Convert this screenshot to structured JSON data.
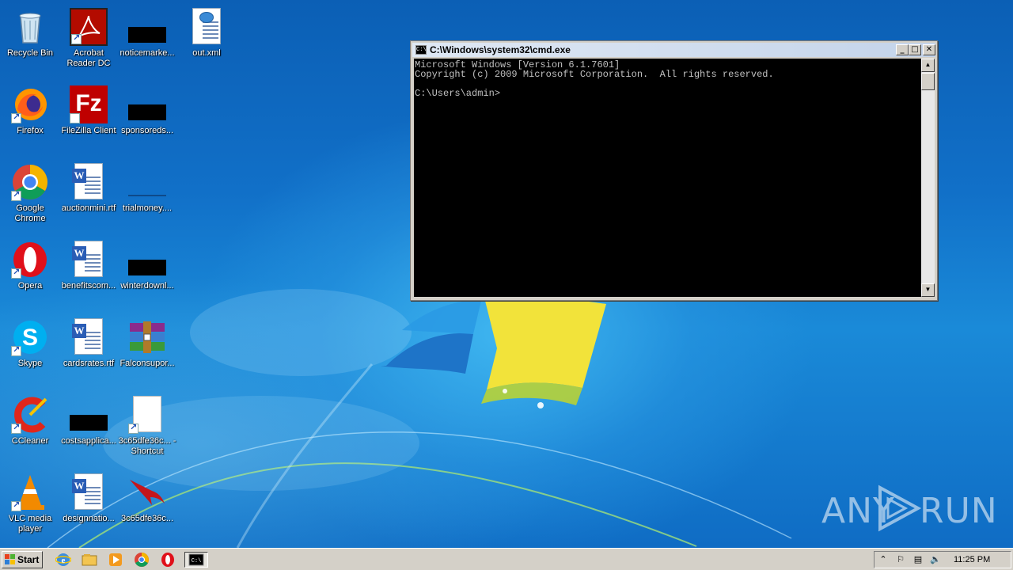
{
  "desktop": {
    "icons": [
      {
        "label": "Recycle Bin",
        "kind": "recycle-bin"
      },
      {
        "label": "Acrobat Reader DC",
        "kind": "acrobat"
      },
      {
        "label": "noticemarke...",
        "kind": "redacted"
      },
      {
        "label": "out.xml",
        "kind": "xml-file"
      },
      {
        "label": "Firefox",
        "kind": "firefox"
      },
      {
        "label": "FileZilla Client",
        "kind": "filezilla"
      },
      {
        "label": "sponsoreds...",
        "kind": "redacted"
      },
      {
        "label": "Google Chrome",
        "kind": "chrome"
      },
      {
        "label": "auctionmini.rtf",
        "kind": "word-doc"
      },
      {
        "label": "trialmoney....",
        "kind": "blank"
      },
      {
        "label": "Opera",
        "kind": "opera"
      },
      {
        "label": "benefitscom...",
        "kind": "word-doc"
      },
      {
        "label": "winterdownl...",
        "kind": "redacted"
      },
      {
        "label": "Skype",
        "kind": "skype"
      },
      {
        "label": "cardsrates.rtf",
        "kind": "word-doc"
      },
      {
        "label": "Falconsupor...",
        "kind": "winrar"
      },
      {
        "label": "CCleaner",
        "kind": "ccleaner"
      },
      {
        "label": "costsapplica...",
        "kind": "redacted"
      },
      {
        "label": "3c65dfe36c... - Shortcut",
        "kind": "shortcut-file"
      },
      {
        "label": "VLC media player",
        "kind": "vlc"
      },
      {
        "label": "designnatio...",
        "kind": "word-doc"
      },
      {
        "label": "3c65dfe36c...",
        "kind": "falcon"
      }
    ]
  },
  "cmd": {
    "title": "C:\\Windows\\system32\\cmd.exe",
    "minimize": "_",
    "maximize": "□",
    "close": "✕",
    "lines": [
      "Microsoft Windows [Version 6.1.7601]",
      "Copyright (c) 2009 Microsoft Corporation.  All rights reserved.",
      "",
      "C:\\Users\\admin>"
    ]
  },
  "watermark": {
    "left": "ANY",
    "right": "RUN"
  },
  "taskbar": {
    "start_label": "Start",
    "pinned": [
      "ie-icon",
      "explorer-icon",
      "media-player-icon",
      "chrome-icon",
      "opera-icon",
      "cmd-icon"
    ],
    "clock": "11:25 PM"
  }
}
